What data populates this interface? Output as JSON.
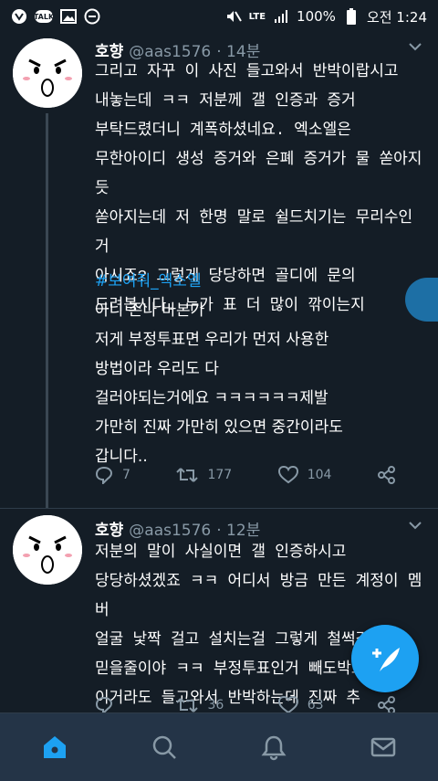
{
  "status_bar": {
    "battery": "100%",
    "time": "오전 1:24",
    "signal": "LTE",
    "talk_label": "TALK"
  },
  "tweets": [
    {
      "name": "호향",
      "handle": "@aas1576",
      "time": "· 14분",
      "text": "그리고 자꾸 이 사진 들고와서 반박이랍시고\n내놓는데 ㅋㅋ 저분께 갤 인증과 증거\n부탁드렸더니 계폭하셨네요. 엑소엘은\n무한아이디 생성 증거와 은폐 증거가 물 쏟아지듯\n쏟아지는데 저 한명 말로 쉴드치기는 무리수인거\n아시죠? 그렇게 당당하면 골디에 문의\n드려봅시다. 누가 표 더 많이 깎이는지",
      "quote": {
        "hashtag": "#보여줘_엑소엘",
        "text": "아니 존나 바본가\n저게 부정투표면 우리가 먼저 사용한\n방법이라 우리도 다\n걸러야되는거에요 ㅋㅋㅋㅋㅋㅋ제발\n가만히 진짜 가만히 있으면 중간이라도\n갑니다.."
      },
      "replies": "7",
      "retweets": "177",
      "likes": "104"
    },
    {
      "name": "호향",
      "handle": "@aas1576",
      "time": "· 12분",
      "text": "저분의 말이 사실이면 갤 인증하시고\n당당하셨겠죠 ㅋㅋ 어디서 방금 만든 계정이 멤버\n얼굴 낯짝 걸고 설치는걸 그렇게 철썩같이\n믿을줄이야 ㅋㅋ 부정투표인거 빼도박도\n이거라도 들고와서 반박하는데 진짜 추",
      "replies": "",
      "retweets": "36",
      "likes": "63"
    }
  ],
  "colors": {
    "background": "#141d26",
    "accent": "#1da1f2",
    "muted": "#8899a6",
    "tabbar": "#243447"
  },
  "icons": [
    "home-icon",
    "search-icon",
    "notifications-icon",
    "messages-icon",
    "compose-icon"
  ]
}
